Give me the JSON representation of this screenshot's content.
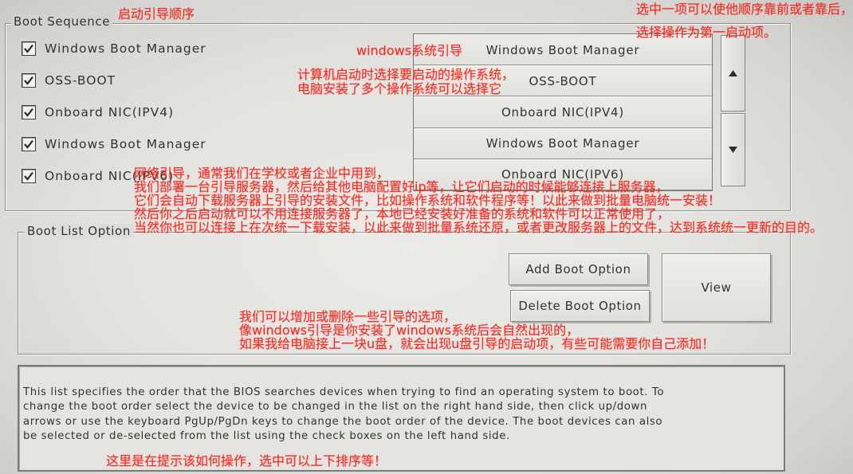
{
  "boot_sequence": {
    "label": "Boot Sequence",
    "items": [
      {
        "label": "Windows Boot Manager",
        "checked": true
      },
      {
        "label": "OSS-BOOT",
        "checked": true
      },
      {
        "label": "Onboard NIC(IPV4)",
        "checked": true
      },
      {
        "label": "Windows Boot Manager",
        "checked": true
      },
      {
        "label": "Onboard NIC(IPV6)",
        "checked": true
      }
    ],
    "order_list": [
      "Windows Boot Manager",
      "OSS-BOOT",
      "Onboard NIC(IPV4)",
      "Windows Boot Manager",
      "Onboard NIC(IPV6)"
    ],
    "move_up_icon": "triangle-up-icon",
    "move_down_icon": "triangle-down-icon"
  },
  "boot_list_option": {
    "label": "Boot List Option",
    "add_label": "Add Boot Option",
    "delete_label": "Delete Boot Option",
    "view_label": "View"
  },
  "help": {
    "lines": [
      "This list specifies the order that the BIOS searches devices when trying to find an operating system to boot. To",
      "change the boot order select the device to be changed in the list on the right hand side, then click up/down",
      "arrows or use the keyboard PgUp/PgDn keys to change the boot order of the device. The boot devices can also",
      "be selected or de-selected from the list using the check boxes on the left hand side."
    ]
  },
  "annotations": {
    "color": "#ff2a1f",
    "boot_sequence_note": "启动引导顺序",
    "reorder_note": [
      "选中一项可以使他顺序靠前或者靠后，",
      "选择操作为第一启动项。"
    ],
    "windows_note": "windows系统引导",
    "os_select_note": [
      "计算机启动时选择要启动的操作系统，",
      "电脑安装了多个操作系统可以选择它"
    ],
    "network_boot_note": [
      "网络引导，通常我们在学校或者企业中用到，",
      "我们部署一台引导服务器，然后给其他电脑配置好ip等，让它们启动的时候能够连接上服务器，",
      "它们会自动下载服务器上引导的安装文件，比如操作系统和软件程序等！以此来做到批量电脑统一安装！",
      "然后你之后启动就可以不用连接服务器了，本地已经安装好准备的系统和软件可以正常使用了，",
      "当然你也可以连接上在次统一下载安装，以此来做到批量系统还原，或者更改服务器上的文件，达到系统统一更新的目的。"
    ],
    "boot_option_note": [
      "我们可以增加或删除一些引导的选项，",
      "像windows引导是你安装了windows系统后会自然出现的，",
      "如果我给电脑接上一块u盘，就会出现u盘引导的启动项，有些可能需要你自己添加！"
    ],
    "help_note": "这里是在提示该如何操作，选中可以上下排序等！"
  }
}
